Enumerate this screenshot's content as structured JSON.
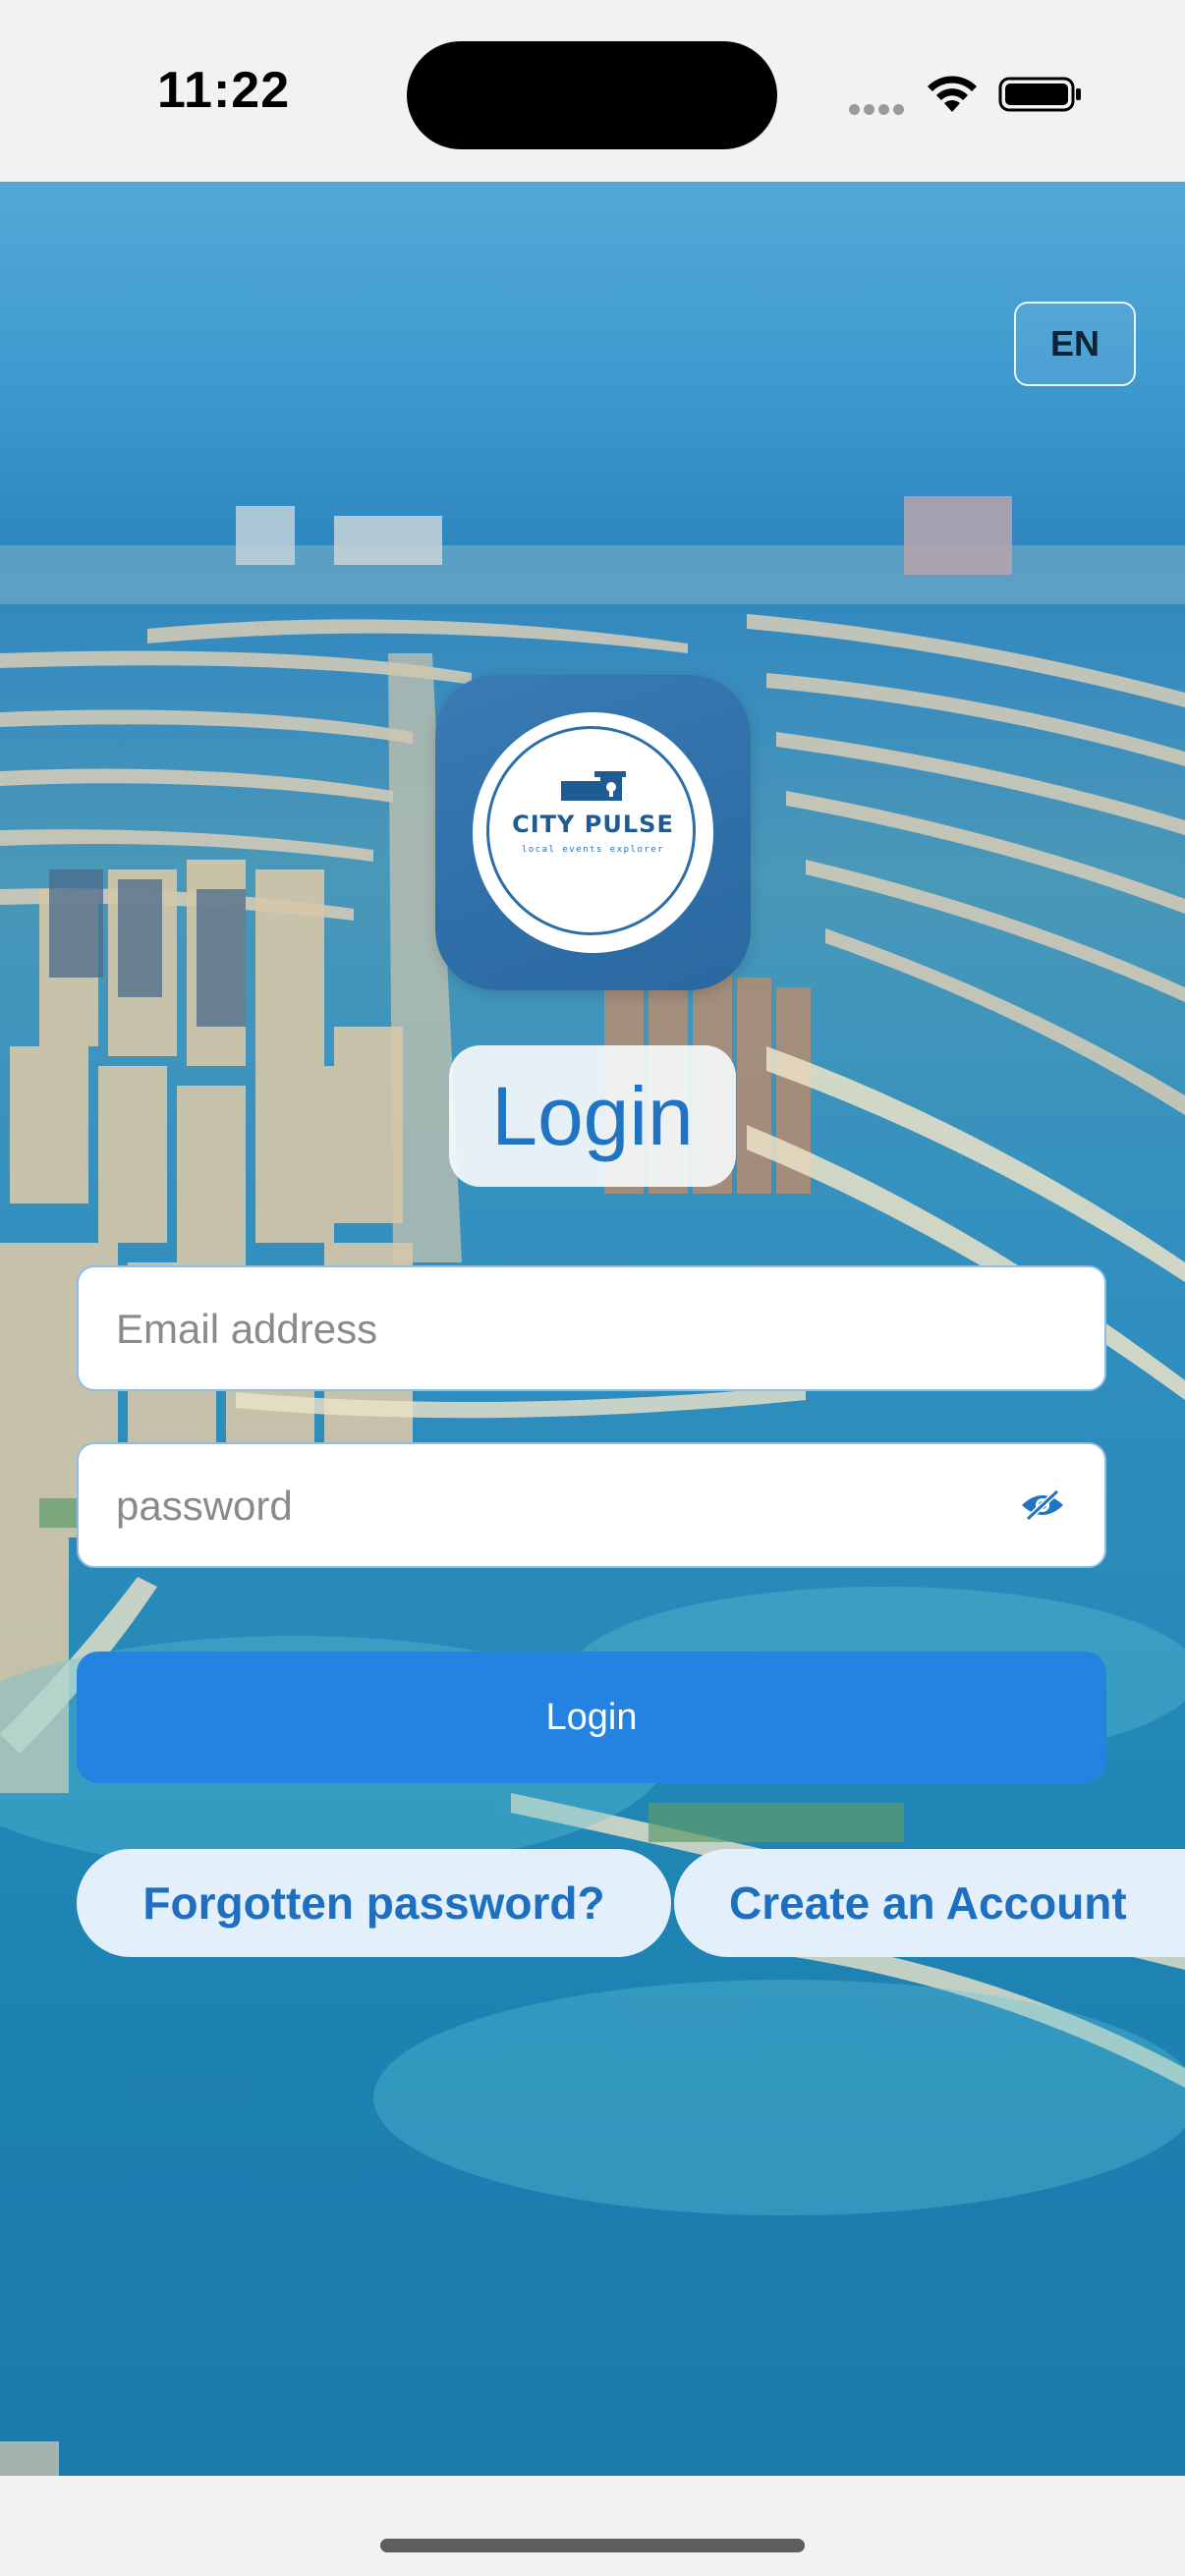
{
  "status_bar": {
    "time": "11:22"
  },
  "language": {
    "label": "EN"
  },
  "logo": {
    "name": "CITY PULSE",
    "tagline": "local events explorer"
  },
  "title": "Login",
  "form": {
    "email_placeholder": "Email address",
    "password_placeholder": "password"
  },
  "login_button": "Login",
  "links": {
    "forgot": "Forgotten password?",
    "create": "Create an Account"
  },
  "icons": {
    "wifi": "wifi-icon",
    "battery": "battery-icon",
    "signal": "signal-dots-icon",
    "eye": "eye-slash-icon"
  },
  "colors": {
    "accent": "#2483e0",
    "link": "#1f6fc0",
    "title": "#1f74c4",
    "link_pill_bg": "#e3f0fb",
    "logo_tile": "#2f6fa8"
  }
}
